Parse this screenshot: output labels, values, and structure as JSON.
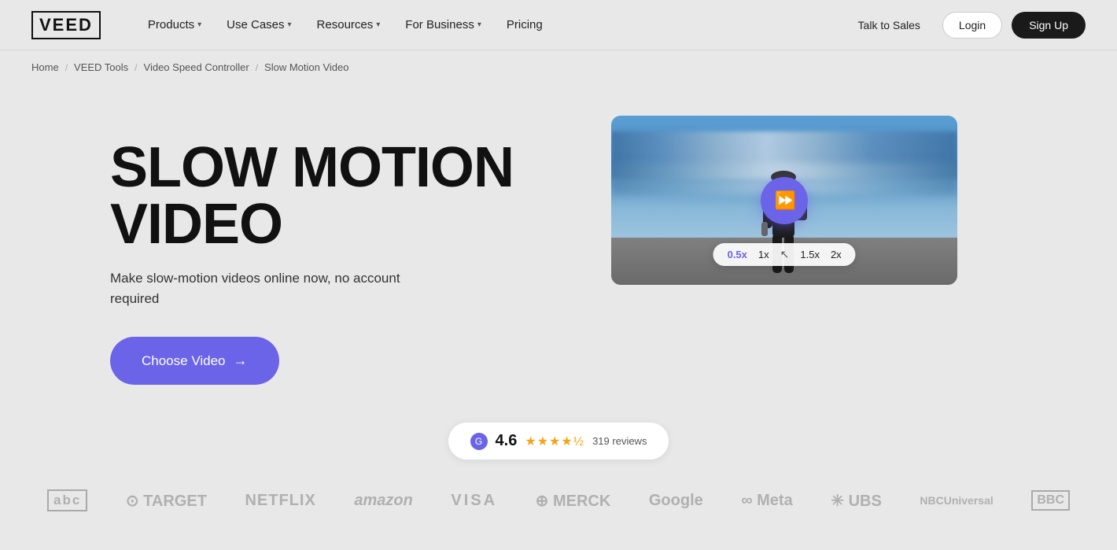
{
  "nav": {
    "logo": "VEED",
    "links": [
      {
        "label": "Products",
        "has_dropdown": true
      },
      {
        "label": "Use Cases",
        "has_dropdown": true
      },
      {
        "label": "Resources",
        "has_dropdown": true
      },
      {
        "label": "For Business",
        "has_dropdown": true
      },
      {
        "label": "Pricing",
        "has_dropdown": false
      }
    ],
    "talk_to_sales": "Talk to Sales",
    "login": "Login",
    "signup": "Sign Up"
  },
  "breadcrumb": {
    "items": [
      "Home",
      "VEED Tools",
      "Video Speed Controller",
      "Slow Motion Video"
    ]
  },
  "hero": {
    "title": "SLOW MOTION VIDEO",
    "subtitle": "Make slow-motion videos online now, no account required",
    "cta_label": "Choose Video",
    "cta_arrow": "→"
  },
  "video_player": {
    "speed_options": [
      "0.5x",
      "1x",
      "1.5x",
      "2x"
    ],
    "active_speed": "0.5x"
  },
  "rating": {
    "icon": "G",
    "score": "4.6",
    "stars": "★★★★½",
    "reviews": "319 reviews"
  },
  "brands": [
    {
      "name": "ABC",
      "display": "abc"
    },
    {
      "name": "Target",
      "display": "⊙ TARGET"
    },
    {
      "name": "Netflix",
      "display": "NETFLIX"
    },
    {
      "name": "Amazon",
      "display": "amazon"
    },
    {
      "name": "Visa",
      "display": "VISA"
    },
    {
      "name": "Merck",
      "display": "⊕ MERCK"
    },
    {
      "name": "Google",
      "display": "Google"
    },
    {
      "name": "Meta",
      "display": "∞ Meta"
    },
    {
      "name": "UBS",
      "display": "✳ UBS"
    },
    {
      "name": "NBCUniversal",
      "display": "NBCUniversal"
    },
    {
      "name": "BBC",
      "display": "BBC"
    }
  ]
}
